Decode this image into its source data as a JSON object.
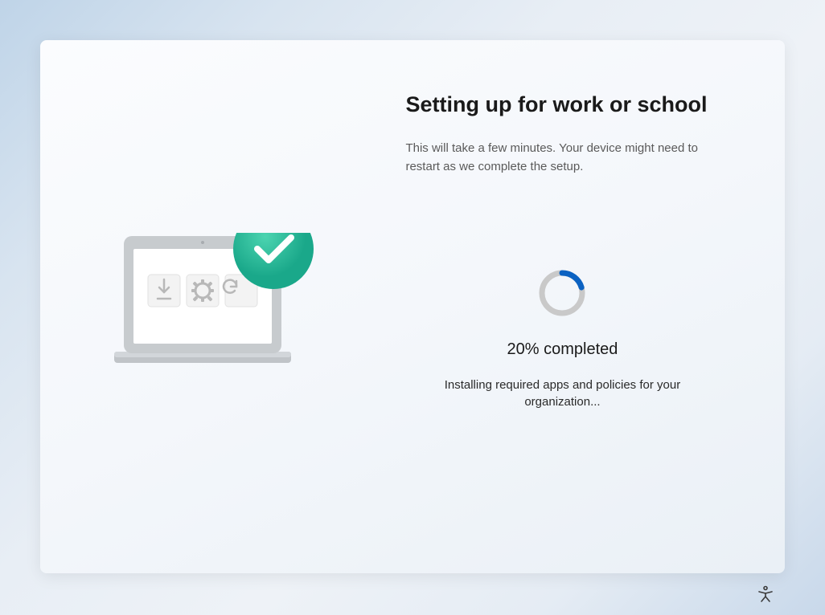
{
  "main": {
    "title": "Setting up for work or school",
    "subtitle": "This will take a few minutes. Your device might need to restart as we complete the setup.",
    "progress_label": "20% completed",
    "status_label": "Installing required apps and policies for your organization...",
    "progress_percent": 20
  },
  "colors": {
    "accent_blue": "#0b62c2",
    "ring_gray": "#c9c9c9",
    "check_badge": "#27b99a"
  }
}
